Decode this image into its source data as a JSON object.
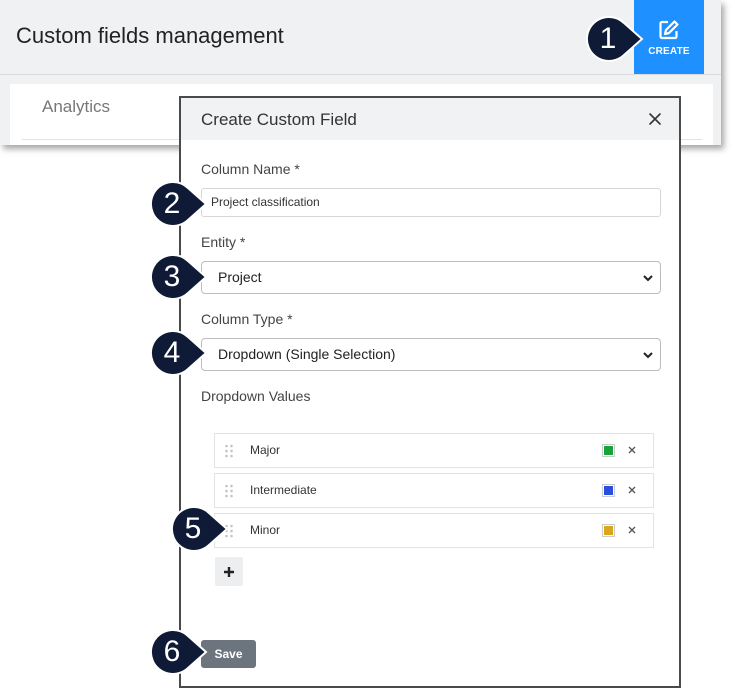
{
  "page": {
    "title": "Custom fields management",
    "create_label": "CREATE",
    "tab_analytics": "Analytics"
  },
  "modal": {
    "title": "Create Custom Field",
    "column_name_label": "Column Name *",
    "column_name_value": "Project classification",
    "entity_label": "Entity *",
    "entity_value": "Project",
    "column_type_label": "Column Type *",
    "column_type_value": "Dropdown (Single Selection)",
    "dropdown_values_label": "Dropdown Values",
    "dropdown_values": [
      {
        "name": "Major",
        "color": "#1aa33a"
      },
      {
        "name": "Intermediate",
        "color": "#2a4fe0"
      },
      {
        "name": "Minor",
        "color": "#d9a81a"
      }
    ],
    "save_label": "Save"
  },
  "callouts": [
    "1",
    "2",
    "3",
    "4",
    "5",
    "6"
  ],
  "colors": {
    "accent": "#1e90ff",
    "callout": "#0f1a36",
    "save_button": "#6c757d"
  },
  "icons": {
    "create": "edit-square-icon",
    "close": "close-icon",
    "select": "chevron-down-icon",
    "drag": "drag-handle-icon",
    "remove": "close-icon",
    "add": "plus-icon"
  }
}
